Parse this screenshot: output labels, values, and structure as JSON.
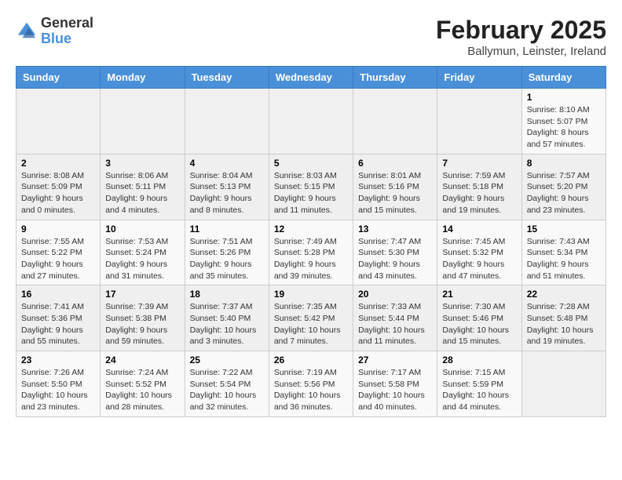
{
  "logo": {
    "general": "General",
    "blue": "Blue"
  },
  "title": "February 2025",
  "location": "Ballymun, Leinster, Ireland",
  "weekdays": [
    "Sunday",
    "Monday",
    "Tuesday",
    "Wednesday",
    "Thursday",
    "Friday",
    "Saturday"
  ],
  "weeks": [
    [
      {
        "day": "",
        "info": ""
      },
      {
        "day": "",
        "info": ""
      },
      {
        "day": "",
        "info": ""
      },
      {
        "day": "",
        "info": ""
      },
      {
        "day": "",
        "info": ""
      },
      {
        "day": "",
        "info": ""
      },
      {
        "day": "1",
        "info": "Sunrise: 8:10 AM\nSunset: 5:07 PM\nDaylight: 8 hours and 57 minutes."
      }
    ],
    [
      {
        "day": "2",
        "info": "Sunrise: 8:08 AM\nSunset: 5:09 PM\nDaylight: 9 hours and 0 minutes."
      },
      {
        "day": "3",
        "info": "Sunrise: 8:06 AM\nSunset: 5:11 PM\nDaylight: 9 hours and 4 minutes."
      },
      {
        "day": "4",
        "info": "Sunrise: 8:04 AM\nSunset: 5:13 PM\nDaylight: 9 hours and 8 minutes."
      },
      {
        "day": "5",
        "info": "Sunrise: 8:03 AM\nSunset: 5:15 PM\nDaylight: 9 hours and 11 minutes."
      },
      {
        "day": "6",
        "info": "Sunrise: 8:01 AM\nSunset: 5:16 PM\nDaylight: 9 hours and 15 minutes."
      },
      {
        "day": "7",
        "info": "Sunrise: 7:59 AM\nSunset: 5:18 PM\nDaylight: 9 hours and 19 minutes."
      },
      {
        "day": "8",
        "info": "Sunrise: 7:57 AM\nSunset: 5:20 PM\nDaylight: 9 hours and 23 minutes."
      }
    ],
    [
      {
        "day": "9",
        "info": "Sunrise: 7:55 AM\nSunset: 5:22 PM\nDaylight: 9 hours and 27 minutes."
      },
      {
        "day": "10",
        "info": "Sunrise: 7:53 AM\nSunset: 5:24 PM\nDaylight: 9 hours and 31 minutes."
      },
      {
        "day": "11",
        "info": "Sunrise: 7:51 AM\nSunset: 5:26 PM\nDaylight: 9 hours and 35 minutes."
      },
      {
        "day": "12",
        "info": "Sunrise: 7:49 AM\nSunset: 5:28 PM\nDaylight: 9 hours and 39 minutes."
      },
      {
        "day": "13",
        "info": "Sunrise: 7:47 AM\nSunset: 5:30 PM\nDaylight: 9 hours and 43 minutes."
      },
      {
        "day": "14",
        "info": "Sunrise: 7:45 AM\nSunset: 5:32 PM\nDaylight: 9 hours and 47 minutes."
      },
      {
        "day": "15",
        "info": "Sunrise: 7:43 AM\nSunset: 5:34 PM\nDaylight: 9 hours and 51 minutes."
      }
    ],
    [
      {
        "day": "16",
        "info": "Sunrise: 7:41 AM\nSunset: 5:36 PM\nDaylight: 9 hours and 55 minutes."
      },
      {
        "day": "17",
        "info": "Sunrise: 7:39 AM\nSunset: 5:38 PM\nDaylight: 9 hours and 59 minutes."
      },
      {
        "day": "18",
        "info": "Sunrise: 7:37 AM\nSunset: 5:40 PM\nDaylight: 10 hours and 3 minutes."
      },
      {
        "day": "19",
        "info": "Sunrise: 7:35 AM\nSunset: 5:42 PM\nDaylight: 10 hours and 7 minutes."
      },
      {
        "day": "20",
        "info": "Sunrise: 7:33 AM\nSunset: 5:44 PM\nDaylight: 10 hours and 11 minutes."
      },
      {
        "day": "21",
        "info": "Sunrise: 7:30 AM\nSunset: 5:46 PM\nDaylight: 10 hours and 15 minutes."
      },
      {
        "day": "22",
        "info": "Sunrise: 7:28 AM\nSunset: 5:48 PM\nDaylight: 10 hours and 19 minutes."
      }
    ],
    [
      {
        "day": "23",
        "info": "Sunrise: 7:26 AM\nSunset: 5:50 PM\nDaylight: 10 hours and 23 minutes."
      },
      {
        "day": "24",
        "info": "Sunrise: 7:24 AM\nSunset: 5:52 PM\nDaylight: 10 hours and 28 minutes."
      },
      {
        "day": "25",
        "info": "Sunrise: 7:22 AM\nSunset: 5:54 PM\nDaylight: 10 hours and 32 minutes."
      },
      {
        "day": "26",
        "info": "Sunrise: 7:19 AM\nSunset: 5:56 PM\nDaylight: 10 hours and 36 minutes."
      },
      {
        "day": "27",
        "info": "Sunrise: 7:17 AM\nSunset: 5:58 PM\nDaylight: 10 hours and 40 minutes."
      },
      {
        "day": "28",
        "info": "Sunrise: 7:15 AM\nSunset: 5:59 PM\nDaylight: 10 hours and 44 minutes."
      },
      {
        "day": "",
        "info": ""
      }
    ]
  ]
}
